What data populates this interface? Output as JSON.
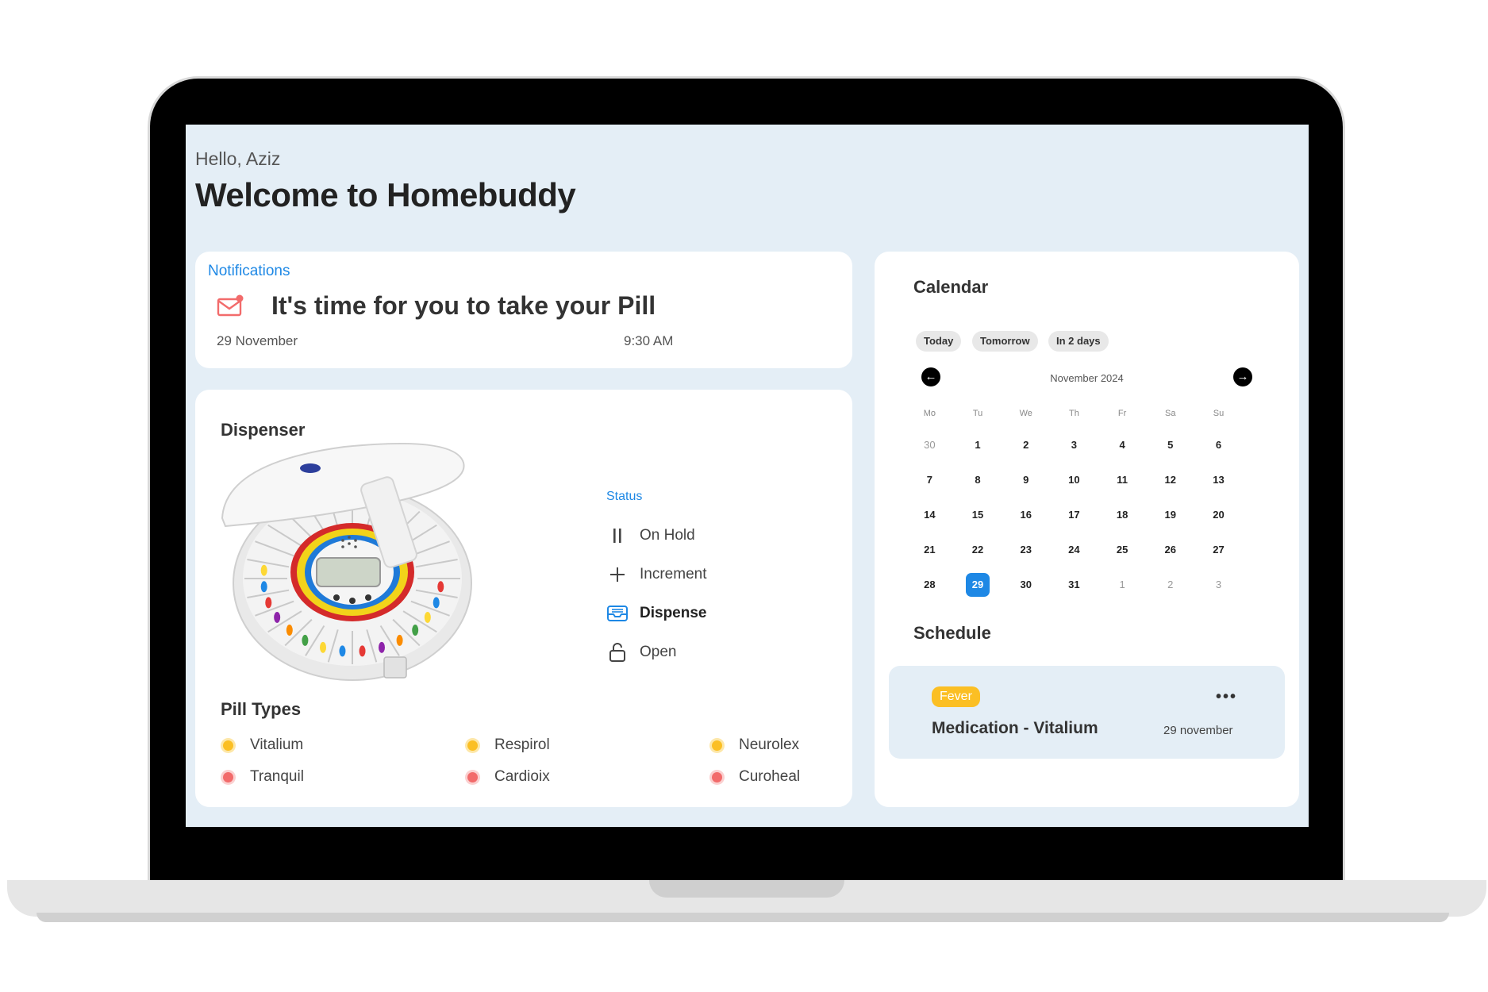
{
  "header": {
    "greeting": "Hello, Aziz",
    "title": "Welcome to Homebuddy"
  },
  "notification": {
    "section_label": "Notifications",
    "icon": "mail-alert-icon",
    "message": "It's time for you to take your Pill",
    "date": "29 November",
    "time": "9:30 AM"
  },
  "dispenser": {
    "title": "Dispenser",
    "status_label": "Status",
    "actions": [
      {
        "label": "On Hold",
        "icon": "pause-icon"
      },
      {
        "label": "Increment",
        "icon": "plus-icon"
      },
      {
        "label": "Dispense",
        "icon": "inbox-tray-icon"
      },
      {
        "label": "Open",
        "icon": "unlock-icon"
      }
    ],
    "active_action": "Dispense",
    "pill_types_title": "Pill Types",
    "pills": [
      {
        "name": "Vitalium",
        "color": "yellow"
      },
      {
        "name": "Respirol",
        "color": "yellow"
      },
      {
        "name": "Neurolex",
        "color": "yellow"
      },
      {
        "name": "Tranquil",
        "color": "red"
      },
      {
        "name": "Cardioix",
        "color": "red"
      },
      {
        "name": "Curoheal",
        "color": "red"
      }
    ]
  },
  "calendar": {
    "title": "Calendar",
    "chips": [
      "Today",
      "Tomorrow",
      "In 2 days"
    ],
    "month_label": "November 2024",
    "weekdays": [
      "Mo",
      "Tu",
      "We",
      "Th",
      "Fr",
      "Sa",
      "Su"
    ],
    "weeks": [
      [
        "30",
        "1",
        "2",
        "3",
        "4",
        "5",
        "6"
      ],
      [
        "7",
        "8",
        "9",
        "10",
        "11",
        "12",
        "13"
      ],
      [
        "14",
        "15",
        "16",
        "17",
        "18",
        "19",
        "20"
      ],
      [
        "21",
        "22",
        "23",
        "24",
        "25",
        "26",
        "27"
      ],
      [
        "28",
        "29",
        "30",
        "31",
        "1",
        "2",
        "3"
      ]
    ],
    "selected_day": "29"
  },
  "schedule": {
    "title": "Schedule",
    "items": [
      {
        "tag": "Fever",
        "name": "Medication - Vitalium",
        "date": "29 november"
      }
    ]
  },
  "colors": {
    "accent": "#1e88e5",
    "screen_bg": "#e4eef6",
    "tag": "#fbbf24",
    "pill_red": "#f26b6b"
  }
}
